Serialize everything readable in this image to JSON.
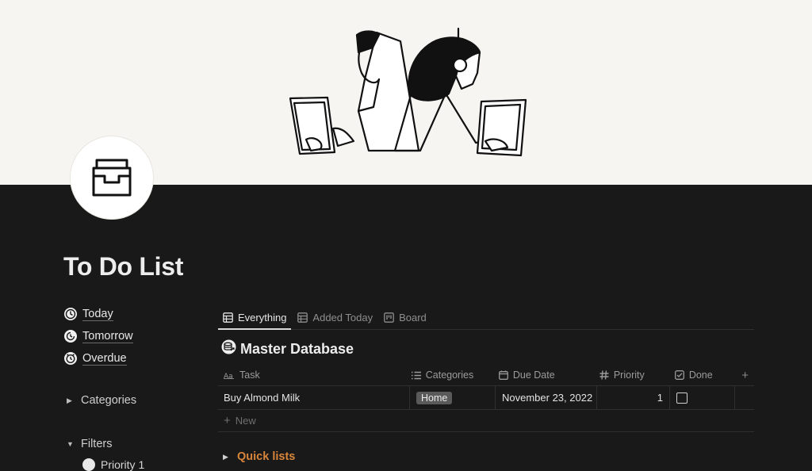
{
  "page": {
    "title": "To Do List"
  },
  "quick_links": [
    {
      "label": "Today",
      "icon": "clock-icon"
    },
    {
      "label": "Tomorrow",
      "icon": "clock-forward-icon"
    },
    {
      "label": "Overdue",
      "icon": "alarm-clock-icon"
    }
  ],
  "toggles": {
    "categories": "Categories",
    "filters": "Filters",
    "filters_first_item": "Priority 1"
  },
  "database": {
    "tabs": [
      {
        "label": "Everything",
        "icon": "table-icon",
        "active": true
      },
      {
        "label": "Added Today",
        "icon": "table-icon",
        "active": false
      },
      {
        "label": "Board",
        "icon": "board-icon",
        "active": false
      }
    ],
    "title": "Master Database",
    "columns": {
      "task": "Task",
      "categories": "Categories",
      "due_date": "Due Date",
      "priority": "Priority",
      "done": "Done"
    },
    "add_column_symbol": "+",
    "rows": [
      {
        "task": "Buy Almond Milk",
        "category": "Home",
        "due_date": "November 23, 2022",
        "priority": "1",
        "done": false
      }
    ],
    "new_label": "New"
  },
  "quick_lists_label": "Quick lists",
  "colors": {
    "background": "#191919",
    "cover": "#f7f5f1",
    "accent_orange": "#d8853b",
    "tag_gray": "#5a5a5a"
  }
}
